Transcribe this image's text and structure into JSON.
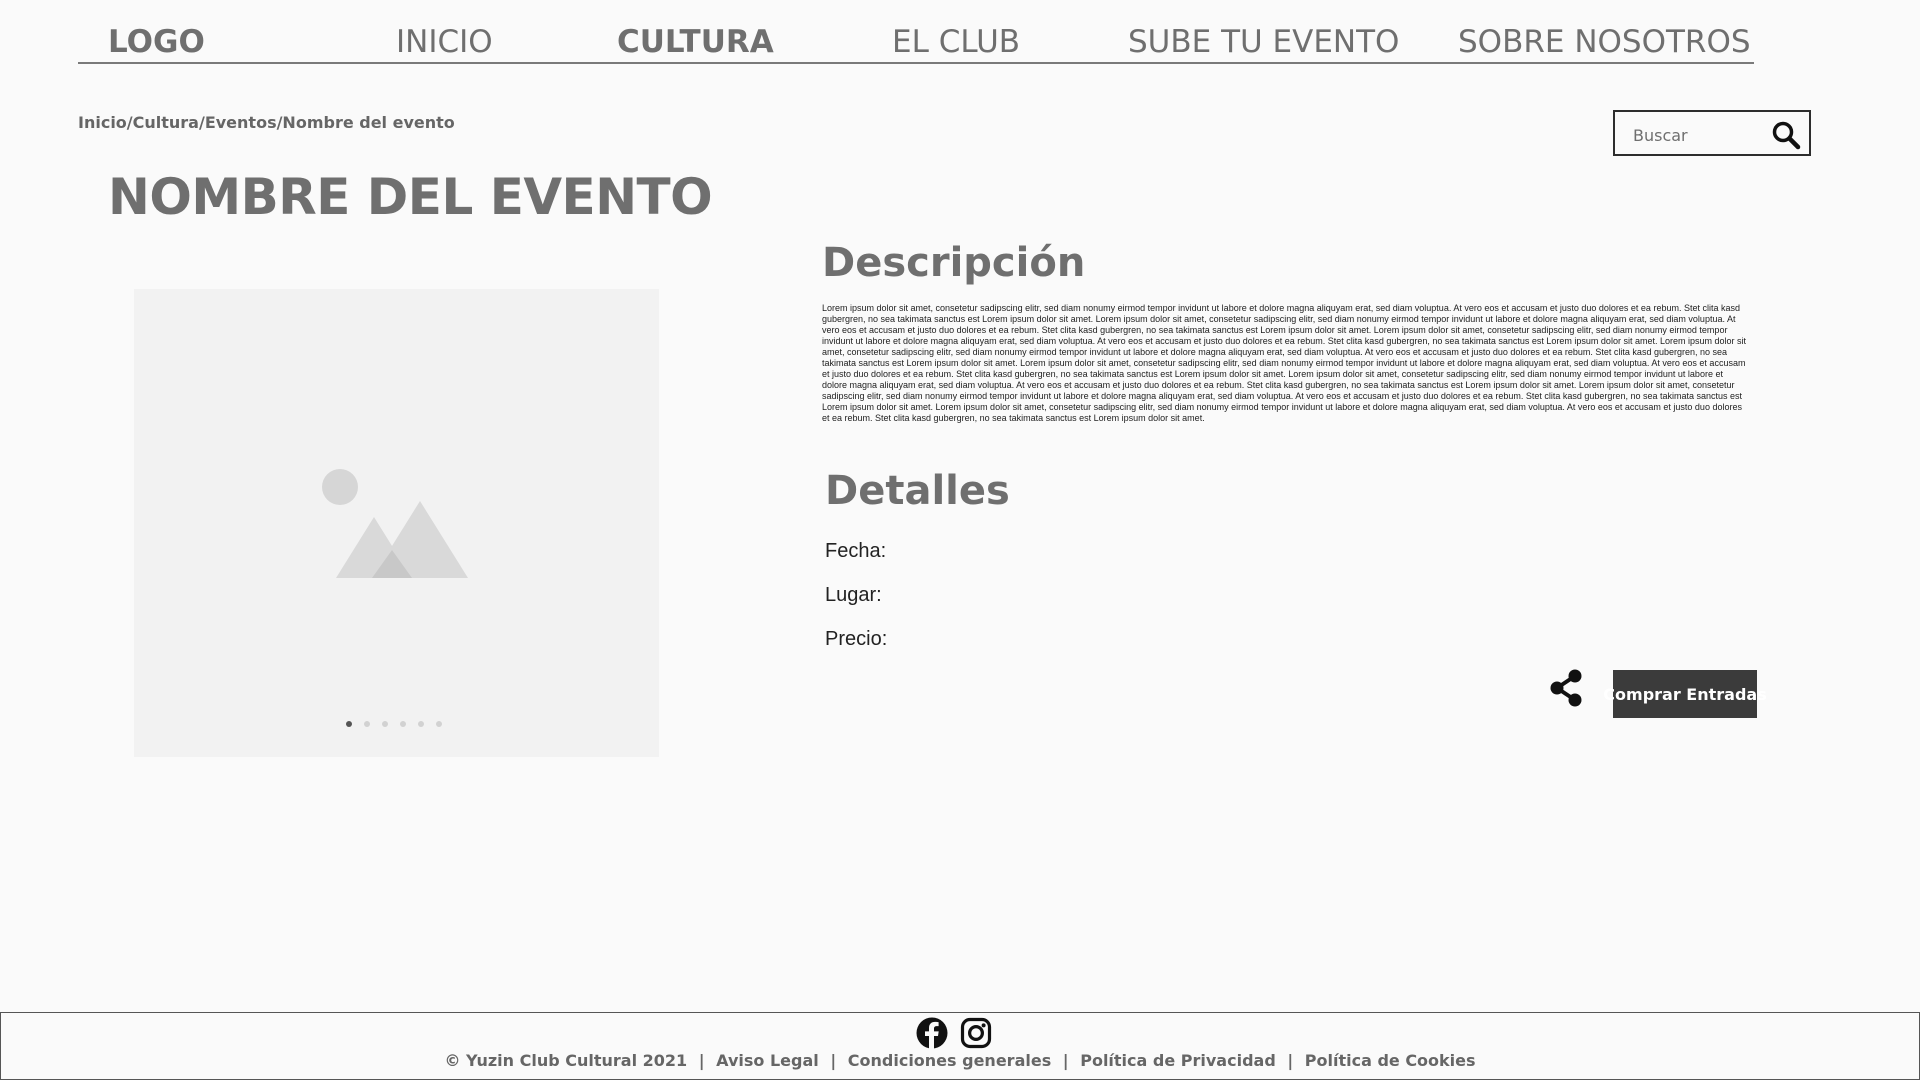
{
  "nav": {
    "logo": "LOGO",
    "items": [
      "INICIO",
      "CULTURA",
      "EL CLUB",
      "SUBE TU EVENTO",
      "SOBRE NOSOTROS"
    ],
    "active": "CULTURA"
  },
  "breadcrumb": "Inicio/Cultura/Eventos/Nombre del evento",
  "search": {
    "placeholder": "Buscar"
  },
  "event": {
    "title": "NOMBRE DEL EVENTO"
  },
  "carousel": {
    "slide_count": 6,
    "active_index": 0
  },
  "description": {
    "heading": "Descripción",
    "text": "Lorem ipsum dolor sit amet, consetetur sadipscing elitr, sed diam nonumy eirmod tempor invidunt ut labore et dolore magna aliquyam erat, sed diam voluptua. At vero eos et accusam et justo duo dolores et ea rebum. Stet clita kasd gubergren, no sea takimata sanctus est Lorem ipsum dolor sit amet. Lorem ipsum dolor sit amet, consetetur sadipscing elitr, sed diam nonumy eirmod tempor invidunt ut labore et dolore magna aliquyam erat, sed diam voluptua. At vero eos et accusam et justo duo dolores et ea rebum. Stet clita kasd gubergren, no sea takimata sanctus est Lorem ipsum dolor sit amet. Lorem ipsum dolor sit amet, consetetur sadipscing elitr, sed diam nonumy eirmod tempor invidunt ut labore et dolore magna aliquyam erat, sed diam voluptua. At vero eos et accusam et justo duo dolores et ea rebum. Stet clita kasd gubergren, no sea takimata sanctus est Lorem ipsum dolor sit amet. Lorem ipsum dolor sit amet, consetetur sadipscing elitr, sed diam nonumy eirmod tempor invidunt ut labore et dolore magna aliquyam erat, sed diam voluptua. At vero eos et accusam et justo duo dolores et ea rebum. Stet clita kasd gubergren, no sea takimata sanctus est Lorem ipsum dolor sit amet. Lorem ipsum dolor sit amet, consetetur sadipscing elitr, sed diam nonumy eirmod tempor invidunt ut labore et dolore magna aliquyam erat, sed diam voluptua. At vero eos et accusam et justo duo dolores et ea rebum. Stet clita kasd gubergren, no sea takimata sanctus est Lorem ipsum dolor sit amet. Lorem ipsum dolor sit amet, consetetur sadipscing elitr, sed diam nonumy eirmod tempor invidunt ut labore et dolore magna aliquyam erat, sed diam voluptua. At vero eos et accusam et justo duo dolores et ea rebum. Stet clita kasd gubergren, no sea takimata sanctus est Lorem ipsum dolor sit amet. Lorem ipsum dolor sit amet, consetetur sadipscing elitr, sed diam nonumy eirmod tempor invidunt ut labore et dolore magna aliquyam erat, sed diam voluptua. At vero eos et accusam et justo duo dolores et ea rebum. Stet clita kasd gubergren, no sea takimata sanctus est Lorem ipsum dolor sit amet. Lorem ipsum dolor sit amet, consetetur sadipscing elitr, sed diam nonumy eirmod tempor invidunt ut labore et dolore magna aliquyam erat, sed diam voluptua. At vero eos et accusam et justo duo dolores et ea rebum. Stet clita kasd gubergren, no sea takimata sanctus est Lorem ipsum dolor sit amet."
  },
  "details": {
    "heading": "Detalles",
    "fecha_label": "Fecha:",
    "lugar_label": "Lugar:",
    "precio_label": "Precio:"
  },
  "actions": {
    "buy_label": "Comprar Entradas"
  },
  "footer": {
    "copyright": "© Yuzin Club Cultural 2021",
    "links": [
      "Aviso Legal",
      "Condiciones generales",
      "Política de Privacidad",
      "Política de Cookies"
    ],
    "separator": "|"
  },
  "colors": {
    "button_bg": "#3b3b3b",
    "text_gray": "#6f6f6f",
    "background": "#fafafa"
  },
  "icons": [
    "search-icon",
    "image-placeholder-icon",
    "share-icon",
    "facebook-icon",
    "instagram-icon"
  ]
}
